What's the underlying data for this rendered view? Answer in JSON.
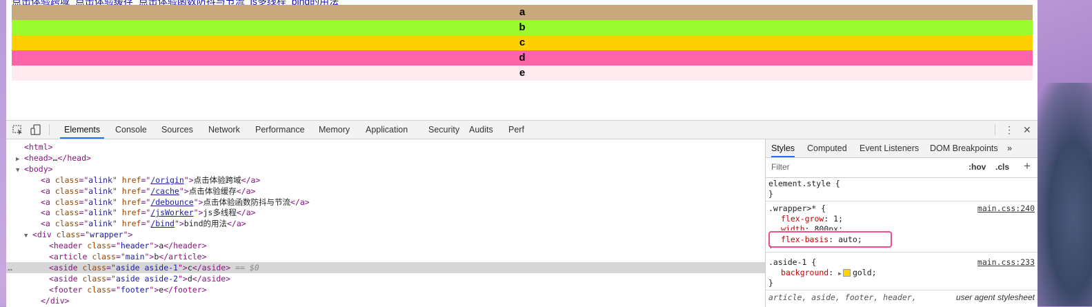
{
  "page": {
    "links": [
      "点击体验跨域",
      "点击体验缓存",
      "点击体验函数防抖与节流",
      "js多线程",
      "bind的用法"
    ],
    "bars": [
      {
        "label": "a",
        "color": "#c8a97e"
      },
      {
        "label": "b",
        "color": "#9afc2f"
      },
      {
        "label": "c",
        "color": "#ffd000"
      },
      {
        "label": "d",
        "color": "#ff63a8"
      },
      {
        "label": "e",
        "color": "#ffeaf0"
      }
    ]
  },
  "devtools": {
    "tabs": [
      "Elements",
      "Console",
      "Sources",
      "Network",
      "Performance",
      "Memory",
      "Application",
      "Security",
      "Audits",
      "Perf"
    ],
    "active_tab": "Elements",
    "icons": {
      "inspect": "inspect-icon",
      "device": "device-toggle-icon",
      "more": "kebab-menu-icon",
      "close": "close-icon"
    },
    "tree": [
      {
        "indent": 0,
        "arrow": "",
        "parts": [
          [
            "tag",
            "<html>"
          ]
        ]
      },
      {
        "indent": 0,
        "arrow": "▶",
        "parts": [
          [
            "tag",
            "<head>"
          ],
          [
            "txt",
            "…"
          ],
          [
            "tag",
            "</head>"
          ]
        ]
      },
      {
        "indent": 0,
        "arrow": "▼",
        "parts": [
          [
            "tag",
            "<body>"
          ]
        ]
      },
      {
        "indent": 2,
        "arrow": "",
        "parts": [
          [
            "tag",
            "<a "
          ],
          [
            "attr",
            "class"
          ],
          [
            "tag",
            "=\""
          ],
          [
            "val",
            "alink"
          ],
          [
            "tag",
            "\" "
          ],
          [
            "attr",
            "href"
          ],
          [
            "tag",
            "=\""
          ],
          [
            "link",
            "/origin"
          ],
          [
            "tag",
            "\">"
          ],
          [
            "txt",
            "点击体验跨域"
          ],
          [
            "tag",
            "</a>"
          ]
        ]
      },
      {
        "indent": 2,
        "arrow": "",
        "parts": [
          [
            "tag",
            "<a "
          ],
          [
            "attr",
            "class"
          ],
          [
            "tag",
            "=\""
          ],
          [
            "val",
            "alink"
          ],
          [
            "tag",
            "\" "
          ],
          [
            "attr",
            "href"
          ],
          [
            "tag",
            "=\""
          ],
          [
            "link",
            "/cache"
          ],
          [
            "tag",
            "\">"
          ],
          [
            "txt",
            "点击体验缓存"
          ],
          [
            "tag",
            "</a>"
          ]
        ]
      },
      {
        "indent": 2,
        "arrow": "",
        "parts": [
          [
            "tag",
            "<a "
          ],
          [
            "attr",
            "class"
          ],
          [
            "tag",
            "=\""
          ],
          [
            "val",
            "alink"
          ],
          [
            "tag",
            "\" "
          ],
          [
            "attr",
            "href"
          ],
          [
            "tag",
            "=\""
          ],
          [
            "link",
            "/debounce"
          ],
          [
            "tag",
            "\">"
          ],
          [
            "txt",
            "点击体验函数防抖与节流"
          ],
          [
            "tag",
            "</a>"
          ]
        ]
      },
      {
        "indent": 2,
        "arrow": "",
        "parts": [
          [
            "tag",
            "<a "
          ],
          [
            "attr",
            "class"
          ],
          [
            "tag",
            "=\""
          ],
          [
            "val",
            "alink"
          ],
          [
            "tag",
            "\" "
          ],
          [
            "attr",
            "href"
          ],
          [
            "tag",
            "=\""
          ],
          [
            "link",
            "/jsWorker"
          ],
          [
            "tag",
            "\">"
          ],
          [
            "txt",
            "js多线程"
          ],
          [
            "tag",
            "</a>"
          ]
        ]
      },
      {
        "indent": 2,
        "arrow": "",
        "parts": [
          [
            "tag",
            "<a "
          ],
          [
            "attr",
            "class"
          ],
          [
            "tag",
            "=\""
          ],
          [
            "val",
            "alink"
          ],
          [
            "tag",
            "\" "
          ],
          [
            "attr",
            "href"
          ],
          [
            "tag",
            "=\""
          ],
          [
            "link",
            "/bind"
          ],
          [
            "tag",
            "\">"
          ],
          [
            "txt",
            "bind的用法"
          ],
          [
            "tag",
            "</a>"
          ]
        ]
      },
      {
        "indent": 1,
        "arrow": "▼",
        "parts": [
          [
            "tag",
            "<div "
          ],
          [
            "attr",
            "class"
          ],
          [
            "tag",
            "=\""
          ],
          [
            "val",
            "wrapper"
          ],
          [
            "tag",
            "\">"
          ]
        ]
      },
      {
        "indent": 3,
        "arrow": "",
        "parts": [
          [
            "tag",
            "<header "
          ],
          [
            "attr",
            "class"
          ],
          [
            "tag",
            "=\""
          ],
          [
            "val",
            "header"
          ],
          [
            "tag",
            "\">"
          ],
          [
            "txt",
            "a"
          ],
          [
            "tag",
            "</header>"
          ]
        ]
      },
      {
        "indent": 3,
        "arrow": "",
        "parts": [
          [
            "tag",
            "<article "
          ],
          [
            "attr",
            "class"
          ],
          [
            "tag",
            "=\""
          ],
          [
            "val",
            "main"
          ],
          [
            "tag",
            "\">"
          ],
          [
            "txt",
            "b"
          ],
          [
            "tag",
            "</article>"
          ]
        ]
      },
      {
        "indent": 3,
        "arrow": "",
        "selected": true,
        "parts": [
          [
            "tag",
            "<aside "
          ],
          [
            "attr",
            "class"
          ],
          [
            "tag",
            "=\""
          ],
          [
            "val",
            "aside aside-1"
          ],
          [
            "tag",
            "\">"
          ],
          [
            "txt",
            "c"
          ],
          [
            "tag",
            "</aside>"
          ],
          [
            "eq",
            " == $0"
          ]
        ]
      },
      {
        "indent": 3,
        "arrow": "",
        "parts": [
          [
            "tag",
            "<aside "
          ],
          [
            "attr",
            "class"
          ],
          [
            "tag",
            "=\""
          ],
          [
            "val",
            "aside aside-2"
          ],
          [
            "tag",
            "\">"
          ],
          [
            "txt",
            "d"
          ],
          [
            "tag",
            "</aside>"
          ]
        ]
      },
      {
        "indent": 3,
        "arrow": "",
        "parts": [
          [
            "tag",
            "<footer "
          ],
          [
            "attr",
            "class"
          ],
          [
            "tag",
            "=\""
          ],
          [
            "val",
            "footer"
          ],
          [
            "tag",
            "\">"
          ],
          [
            "txt",
            "e"
          ],
          [
            "tag",
            "</footer>"
          ]
        ]
      },
      {
        "indent": 2,
        "arrow": "",
        "parts": [
          [
            "tag",
            "</div>"
          ]
        ]
      }
    ],
    "styles_tabs": [
      "Styles",
      "Computed",
      "Event Listeners",
      "DOM Breakpoints",
      "»"
    ],
    "filter_placeholder": "Filter",
    "hov": ":hov",
    "cls": ".cls",
    "plus": "+",
    "rules": {
      "element_style": "element.style {",
      "close": "}",
      "wrapper_selector": ".wrapper>* {",
      "wrapper_src": "main.css:240",
      "wrapper_props": [
        [
          "flex-grow",
          "1"
        ],
        [
          "width",
          "800px"
        ],
        [
          "flex-basis",
          "auto"
        ]
      ],
      "aside_selector": ".aside-1 {",
      "aside_src": "main.css:233",
      "aside_prop": "background",
      "aside_val": "gold",
      "aside_swatch": "#ffd700",
      "ua_selector": "article, aside, footer, header,",
      "ua_src": "user agent stylesheet"
    }
  }
}
